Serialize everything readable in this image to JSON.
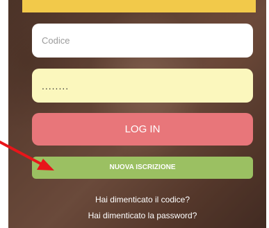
{
  "form": {
    "code_placeholder": "Codice",
    "password_value": "........",
    "login_label": "LOG IN",
    "register_label": "NUOVA ISCRIZIONE",
    "forgot_code_label": "Hai dimenticato il codice?",
    "forgot_password_label": "Hai dimenticato la password?"
  },
  "colors": {
    "top_bar": "#f2c94a",
    "password_field_bg": "#fbf7bd",
    "login_button": "#e8767a",
    "register_button": "#9bc062",
    "annotation_arrow": "#e8151a"
  },
  "icons": {
    "annotation": "arrow-right-icon"
  }
}
